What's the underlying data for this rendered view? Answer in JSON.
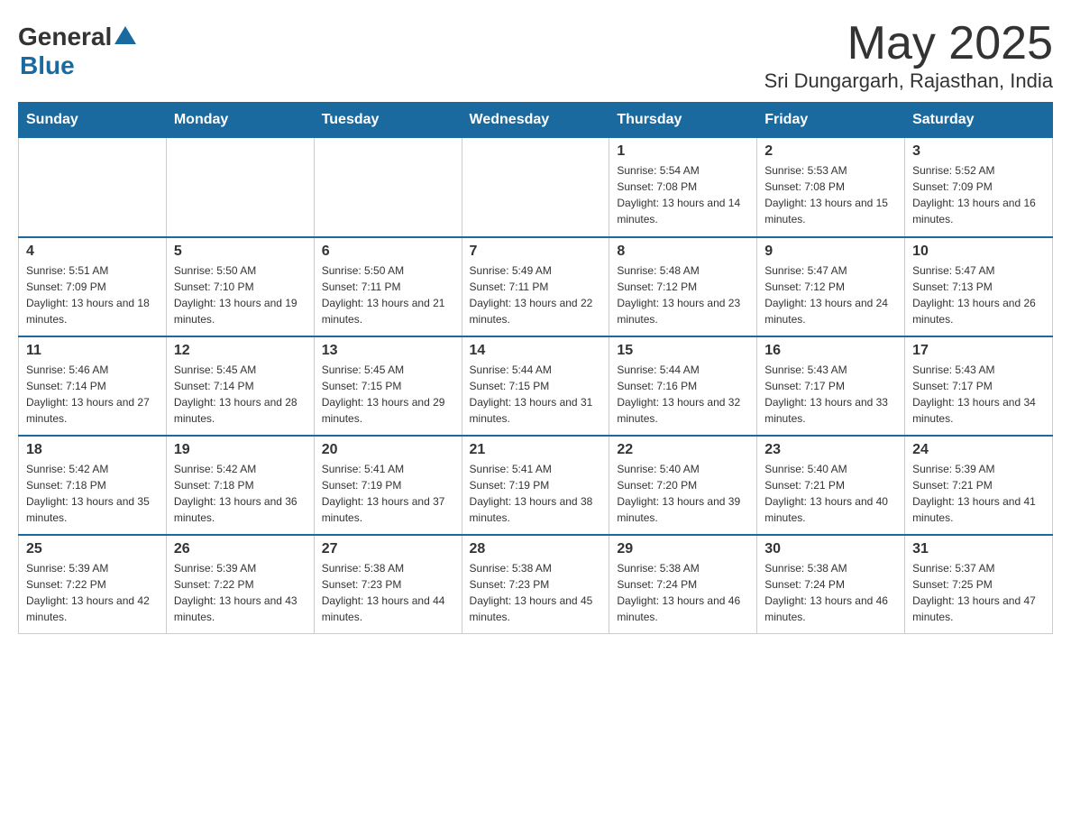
{
  "logo": {
    "general": "General",
    "blue": "Blue"
  },
  "header": {
    "month_year": "May 2025",
    "location": "Sri Dungargarh, Rajasthan, India"
  },
  "weekdays": [
    "Sunday",
    "Monday",
    "Tuesday",
    "Wednesday",
    "Thursday",
    "Friday",
    "Saturday"
  ],
  "weeks": [
    [
      {
        "day": "",
        "sunrise": "",
        "sunset": "",
        "daylight": ""
      },
      {
        "day": "",
        "sunrise": "",
        "sunset": "",
        "daylight": ""
      },
      {
        "day": "",
        "sunrise": "",
        "sunset": "",
        "daylight": ""
      },
      {
        "day": "",
        "sunrise": "",
        "sunset": "",
        "daylight": ""
      },
      {
        "day": "1",
        "sunrise": "Sunrise: 5:54 AM",
        "sunset": "Sunset: 7:08 PM",
        "daylight": "Daylight: 13 hours and 14 minutes."
      },
      {
        "day": "2",
        "sunrise": "Sunrise: 5:53 AM",
        "sunset": "Sunset: 7:08 PM",
        "daylight": "Daylight: 13 hours and 15 minutes."
      },
      {
        "day": "3",
        "sunrise": "Sunrise: 5:52 AM",
        "sunset": "Sunset: 7:09 PM",
        "daylight": "Daylight: 13 hours and 16 minutes."
      }
    ],
    [
      {
        "day": "4",
        "sunrise": "Sunrise: 5:51 AM",
        "sunset": "Sunset: 7:09 PM",
        "daylight": "Daylight: 13 hours and 18 minutes."
      },
      {
        "day": "5",
        "sunrise": "Sunrise: 5:50 AM",
        "sunset": "Sunset: 7:10 PM",
        "daylight": "Daylight: 13 hours and 19 minutes."
      },
      {
        "day": "6",
        "sunrise": "Sunrise: 5:50 AM",
        "sunset": "Sunset: 7:11 PM",
        "daylight": "Daylight: 13 hours and 21 minutes."
      },
      {
        "day": "7",
        "sunrise": "Sunrise: 5:49 AM",
        "sunset": "Sunset: 7:11 PM",
        "daylight": "Daylight: 13 hours and 22 minutes."
      },
      {
        "day": "8",
        "sunrise": "Sunrise: 5:48 AM",
        "sunset": "Sunset: 7:12 PM",
        "daylight": "Daylight: 13 hours and 23 minutes."
      },
      {
        "day": "9",
        "sunrise": "Sunrise: 5:47 AM",
        "sunset": "Sunset: 7:12 PM",
        "daylight": "Daylight: 13 hours and 24 minutes."
      },
      {
        "day": "10",
        "sunrise": "Sunrise: 5:47 AM",
        "sunset": "Sunset: 7:13 PM",
        "daylight": "Daylight: 13 hours and 26 minutes."
      }
    ],
    [
      {
        "day": "11",
        "sunrise": "Sunrise: 5:46 AM",
        "sunset": "Sunset: 7:14 PM",
        "daylight": "Daylight: 13 hours and 27 minutes."
      },
      {
        "day": "12",
        "sunrise": "Sunrise: 5:45 AM",
        "sunset": "Sunset: 7:14 PM",
        "daylight": "Daylight: 13 hours and 28 minutes."
      },
      {
        "day": "13",
        "sunrise": "Sunrise: 5:45 AM",
        "sunset": "Sunset: 7:15 PM",
        "daylight": "Daylight: 13 hours and 29 minutes."
      },
      {
        "day": "14",
        "sunrise": "Sunrise: 5:44 AM",
        "sunset": "Sunset: 7:15 PM",
        "daylight": "Daylight: 13 hours and 31 minutes."
      },
      {
        "day": "15",
        "sunrise": "Sunrise: 5:44 AM",
        "sunset": "Sunset: 7:16 PM",
        "daylight": "Daylight: 13 hours and 32 minutes."
      },
      {
        "day": "16",
        "sunrise": "Sunrise: 5:43 AM",
        "sunset": "Sunset: 7:17 PM",
        "daylight": "Daylight: 13 hours and 33 minutes."
      },
      {
        "day": "17",
        "sunrise": "Sunrise: 5:43 AM",
        "sunset": "Sunset: 7:17 PM",
        "daylight": "Daylight: 13 hours and 34 minutes."
      }
    ],
    [
      {
        "day": "18",
        "sunrise": "Sunrise: 5:42 AM",
        "sunset": "Sunset: 7:18 PM",
        "daylight": "Daylight: 13 hours and 35 minutes."
      },
      {
        "day": "19",
        "sunrise": "Sunrise: 5:42 AM",
        "sunset": "Sunset: 7:18 PM",
        "daylight": "Daylight: 13 hours and 36 minutes."
      },
      {
        "day": "20",
        "sunrise": "Sunrise: 5:41 AM",
        "sunset": "Sunset: 7:19 PM",
        "daylight": "Daylight: 13 hours and 37 minutes."
      },
      {
        "day": "21",
        "sunrise": "Sunrise: 5:41 AM",
        "sunset": "Sunset: 7:19 PM",
        "daylight": "Daylight: 13 hours and 38 minutes."
      },
      {
        "day": "22",
        "sunrise": "Sunrise: 5:40 AM",
        "sunset": "Sunset: 7:20 PM",
        "daylight": "Daylight: 13 hours and 39 minutes."
      },
      {
        "day": "23",
        "sunrise": "Sunrise: 5:40 AM",
        "sunset": "Sunset: 7:21 PM",
        "daylight": "Daylight: 13 hours and 40 minutes."
      },
      {
        "day": "24",
        "sunrise": "Sunrise: 5:39 AM",
        "sunset": "Sunset: 7:21 PM",
        "daylight": "Daylight: 13 hours and 41 minutes."
      }
    ],
    [
      {
        "day": "25",
        "sunrise": "Sunrise: 5:39 AM",
        "sunset": "Sunset: 7:22 PM",
        "daylight": "Daylight: 13 hours and 42 minutes."
      },
      {
        "day": "26",
        "sunrise": "Sunrise: 5:39 AM",
        "sunset": "Sunset: 7:22 PM",
        "daylight": "Daylight: 13 hours and 43 minutes."
      },
      {
        "day": "27",
        "sunrise": "Sunrise: 5:38 AM",
        "sunset": "Sunset: 7:23 PM",
        "daylight": "Daylight: 13 hours and 44 minutes."
      },
      {
        "day": "28",
        "sunrise": "Sunrise: 5:38 AM",
        "sunset": "Sunset: 7:23 PM",
        "daylight": "Daylight: 13 hours and 45 minutes."
      },
      {
        "day": "29",
        "sunrise": "Sunrise: 5:38 AM",
        "sunset": "Sunset: 7:24 PM",
        "daylight": "Daylight: 13 hours and 46 minutes."
      },
      {
        "day": "30",
        "sunrise": "Sunrise: 5:38 AM",
        "sunset": "Sunset: 7:24 PM",
        "daylight": "Daylight: 13 hours and 46 minutes."
      },
      {
        "day": "31",
        "sunrise": "Sunrise: 5:37 AM",
        "sunset": "Sunset: 7:25 PM",
        "daylight": "Daylight: 13 hours and 47 minutes."
      }
    ]
  ]
}
